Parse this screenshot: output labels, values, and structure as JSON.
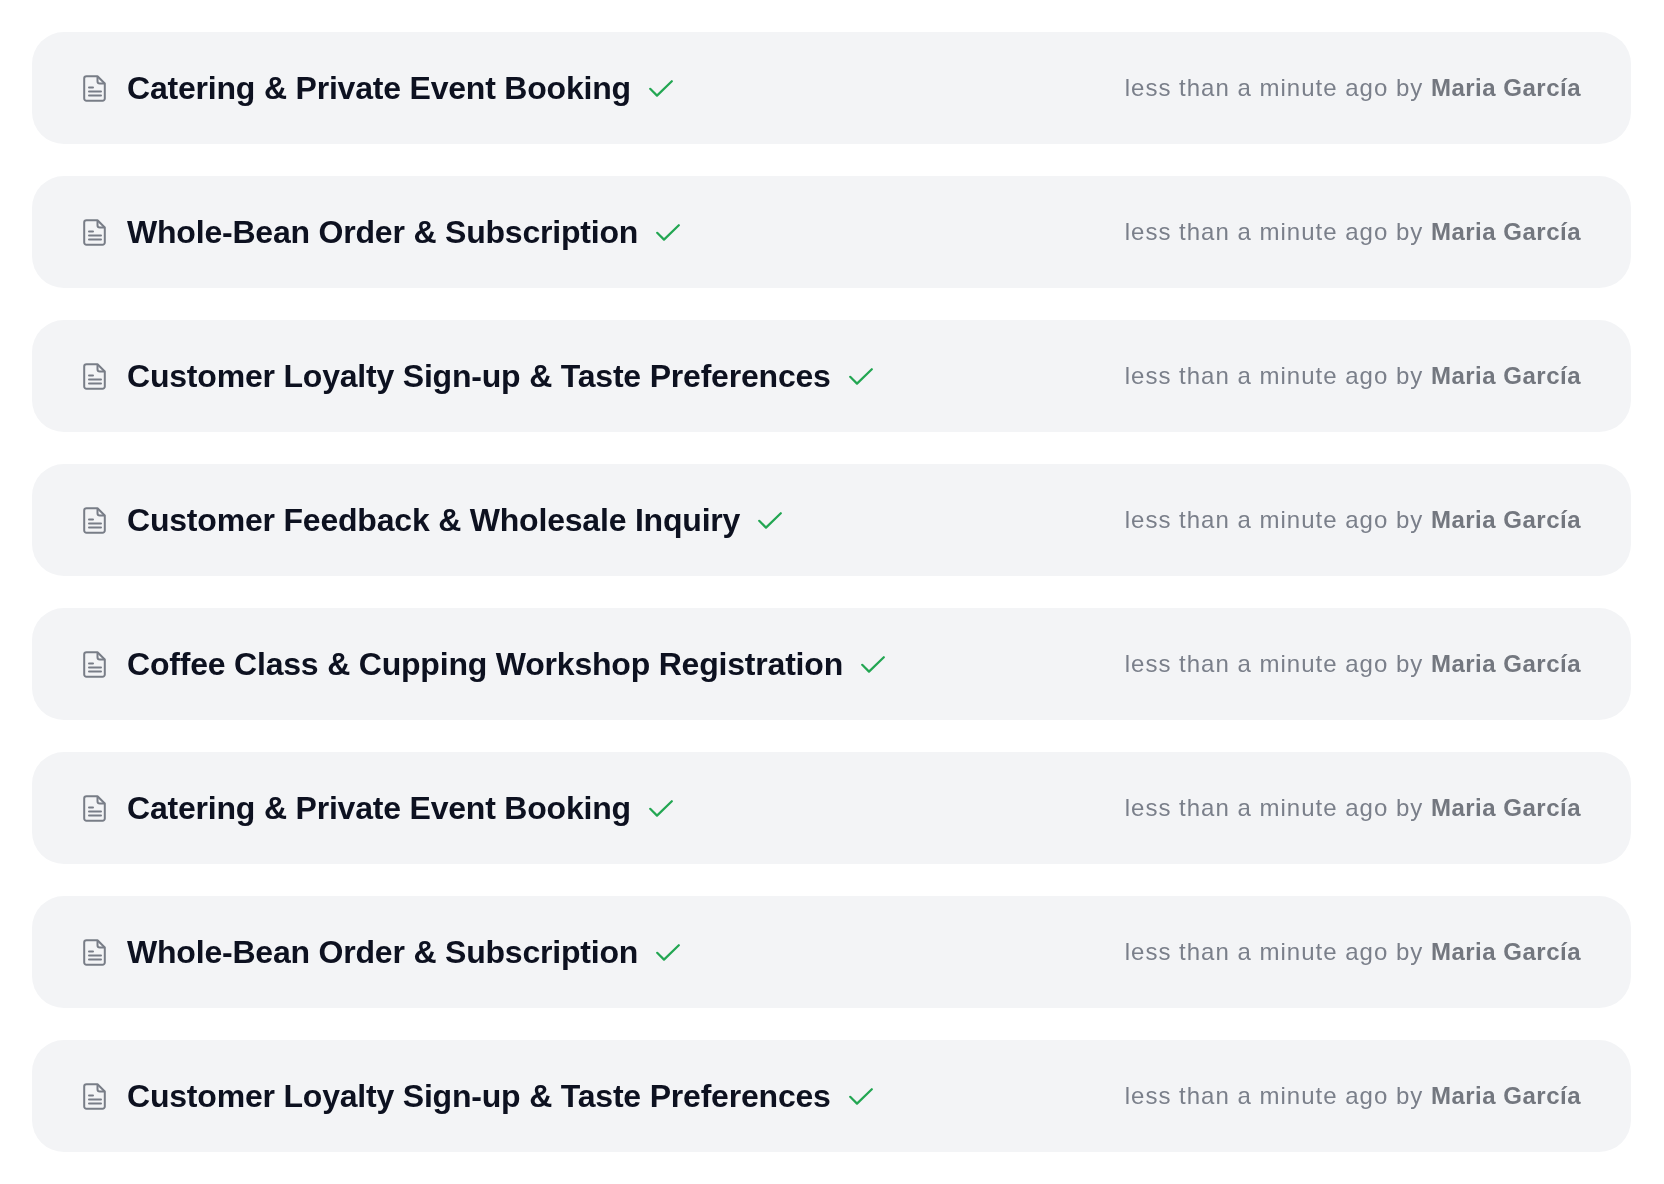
{
  "forms": [
    {
      "title": "Catering & Private Event Booking",
      "complete": true,
      "meta": "less than a minute ago by **Maria García**"
    },
    {
      "title": "Whole-Bean Order & Subscription",
      "complete": true,
      "meta": "less than a minute ago by **Maria García**"
    },
    {
      "title": "Customer Loyalty Sign-up & Taste Preferences",
      "complete": true,
      "meta": "less than a minute ago by **Maria García**"
    },
    {
      "title": "Customer Feedback & Wholesale Inquiry",
      "complete": true,
      "meta": "less than a minute ago by **Maria García**"
    },
    {
      "title": "Coffee Class & Cupping Workshop Registration",
      "complete": true,
      "meta": "less than a minute ago by **Maria García**"
    },
    {
      "title": "Catering & Private Event Booking",
      "complete": true,
      "meta": "less than a minute ago by **Maria García**"
    },
    {
      "title": "Whole-Bean Order & Subscription",
      "complete": true,
      "meta": "less than a minute ago by **Maria García**"
    },
    {
      "title": "Customer Loyalty Sign-up & Taste Preferences",
      "complete": true,
      "meta": "less than a minute ago by **Maria García**"
    }
  ]
}
